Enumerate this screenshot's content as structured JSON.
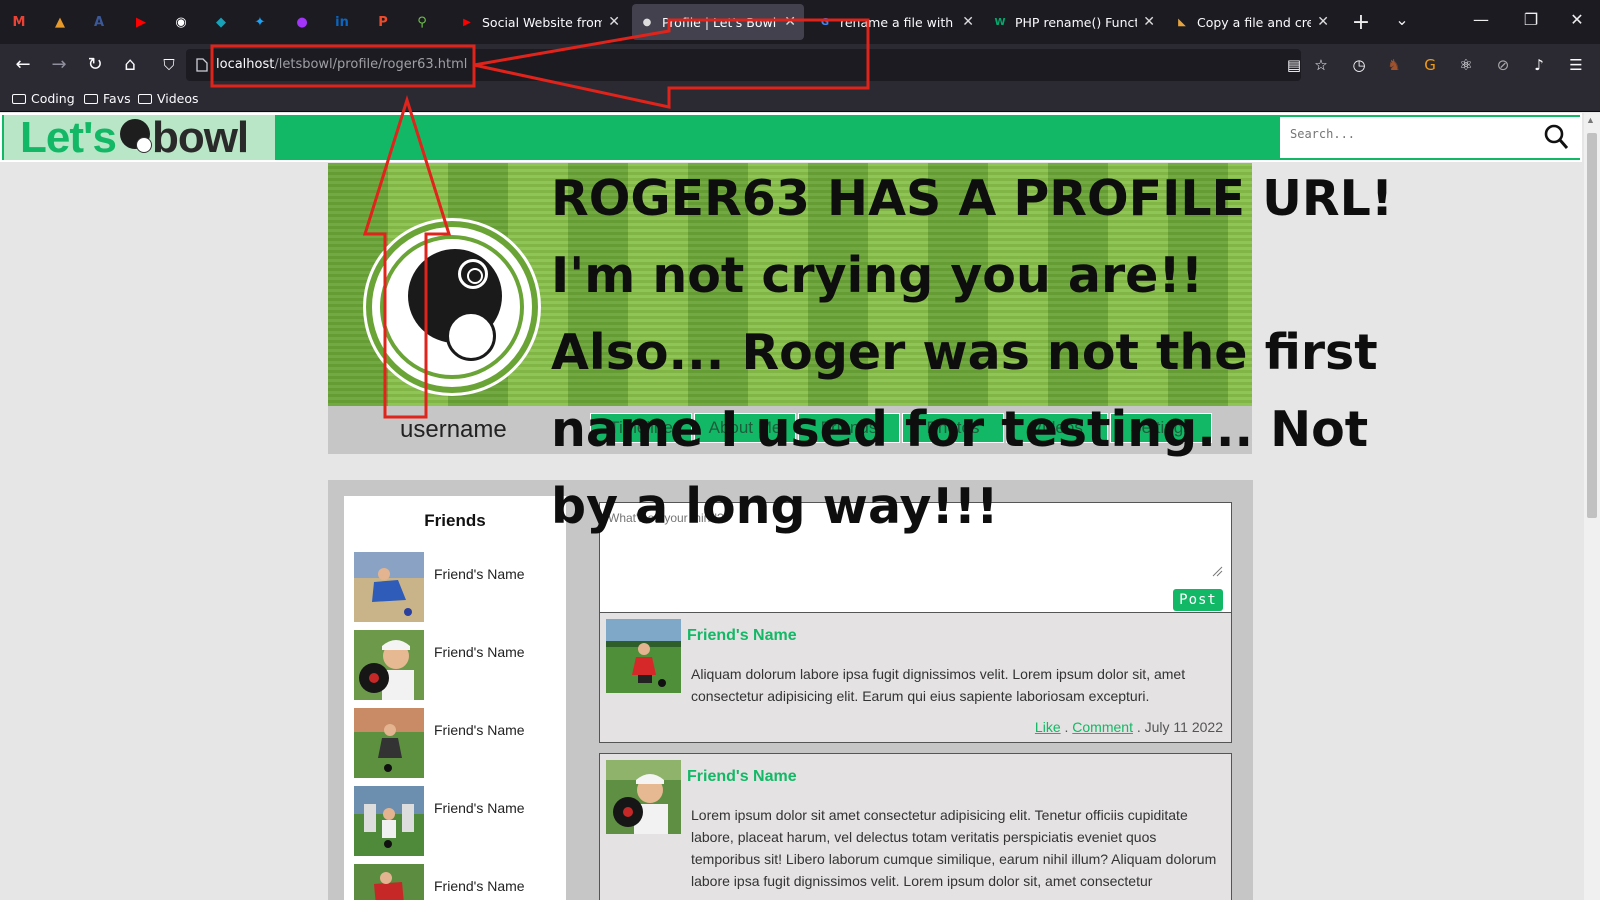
{
  "browser": {
    "pinned": [
      {
        "icon": "gmail-icon",
        "glyph": "M",
        "color": "#ea4335"
      },
      {
        "icon": "mountain-icon",
        "glyph": "▲",
        "color": "#e89b2a"
      },
      {
        "icon": "angular-icon",
        "glyph": "A",
        "color": "#3b5998"
      },
      {
        "icon": "youtube-studio-icon",
        "glyph": "▶",
        "color": "#ff0000"
      },
      {
        "icon": "github-icon",
        "glyph": "◉",
        "color": "#ffffff"
      },
      {
        "icon": "diamond-icon",
        "glyph": "◆",
        "color": "#17a2b8"
      },
      {
        "icon": "twitter-icon",
        "glyph": "✦",
        "color": "#1da1f2"
      },
      {
        "icon": "messenger-icon",
        "glyph": "●",
        "color": "#a334fa"
      },
      {
        "icon": "linkedin-icon",
        "glyph": "in",
        "color": "#0a66c2"
      },
      {
        "icon": "producthunt-icon",
        "glyph": "P",
        "color": "#ef4b2b"
      },
      {
        "icon": "link-icon",
        "glyph": "⚲",
        "color": "#6ec04b"
      }
    ],
    "tabs": [
      {
        "label": "Social Website from sc",
        "icon": "youtube-icon",
        "glyph": "▶",
        "color": "#ff0000",
        "active": false
      },
      {
        "label": "Profile | Let's Bowl",
        "icon": "bowl-icon",
        "glyph": "●",
        "color": "#dddddd",
        "active": true
      },
      {
        "label": "rename a file with php",
        "icon": "google-icon",
        "glyph": "G",
        "color": "#4285f4",
        "active": false
      },
      {
        "label": "PHP rename() Function",
        "icon": "w3schools-icon",
        "glyph": "W",
        "color": "#04aa6d",
        "active": false
      },
      {
        "label": "Copy a file and create",
        "icon": "php-icon",
        "glyph": "◣",
        "color": "#e8a33d",
        "active": false
      }
    ],
    "new_tab": "+",
    "tab_list": "⌄",
    "window": {
      "minimize": "—",
      "restore": "❐",
      "close": "✕"
    },
    "url_host": "localhost",
    "url_path": "/letsbowl/profile/roger63.html",
    "bookmarks": [
      "Coding",
      "Favs",
      "Videos"
    ]
  },
  "site": {
    "logo_lets": "Let's",
    "logo_bowl": "bowl",
    "search_placeholder": "Search...",
    "username": "username",
    "profile_nav": [
      "Timeline",
      "About Me",
      "Friends",
      "Photos",
      "Videos",
      "Settings"
    ],
    "friends_title": "Friends",
    "friends": [
      {
        "name": "Friend's Name",
        "photo": "bowler-blue"
      },
      {
        "name": "Friend's Name",
        "photo": "bowler-closeup"
      },
      {
        "name": "Friend's Name",
        "photo": "bowler-woman"
      },
      {
        "name": "Friend's Name",
        "photo": "bowler-group"
      },
      {
        "name": "Friend's Name",
        "photo": "bowler-red"
      }
    ],
    "composer_placeholder": "What's on your mind?",
    "post_button": "Post",
    "posts": [
      {
        "author": "Friend's Name",
        "body": "Aliquam dolorum labore ipsa fugit dignissimos velit. Lorem ipsum dolor sit, amet consectetur adipisicing elit. Earum qui eius sapiente laboriosam excepturi.",
        "like": "Like",
        "comment": "Comment",
        "date": "July 11 2022"
      },
      {
        "author": "Friend's Name",
        "body": "Lorem ipsum dolor sit amet consectetur adipisicing elit. Tenetur officiis cupiditate labore, placeat harum, vel delectus totam veritatis perspiciatis eveniet quos temporibus sit! Libero laborum cumque similique, earum nihil illum? Aliquam dolorum labore ipsa fugit dignissimos velit. Lorem ipsum dolor sit, amet consectetur"
      }
    ]
  },
  "annotation": {
    "lines": [
      "ROGER63 HAS A PROFILE URL!",
      "I'm not crying you are!!",
      "Also... Roger was not the first",
      "name I used for testing... Not",
      "by a long way!!!"
    ],
    "arrow_color": "#e0231b"
  }
}
